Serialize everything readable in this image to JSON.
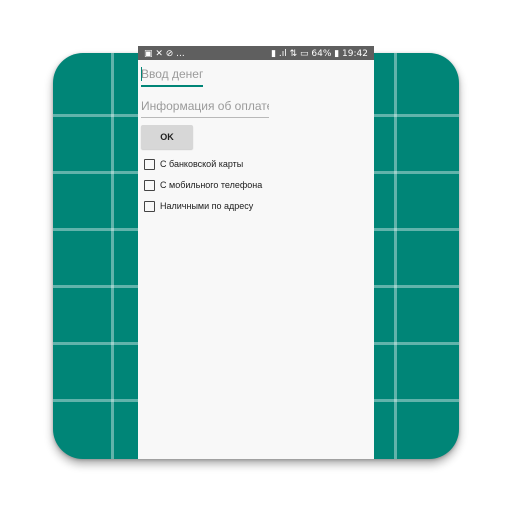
{
  "status_bar": {
    "left_text": "▣ ✕ ⊘ ...",
    "right_text": "▮ .ıl ⇅ ▭ 64% ▮ 19:42"
  },
  "form": {
    "amount_placeholder": "Ввод денег",
    "payment_info_placeholder": "Информация об оплате",
    "ok_label": "OK"
  },
  "options": [
    {
      "label": "С банковской карты",
      "checked": false
    },
    {
      "label": "С мобильного телефона",
      "checked": false
    },
    {
      "label": "Наличными по адресу",
      "checked": false
    }
  ],
  "colors": {
    "accent": "#008577",
    "background": "#f8f8f8",
    "status_bar": "#5f5f5f"
  }
}
